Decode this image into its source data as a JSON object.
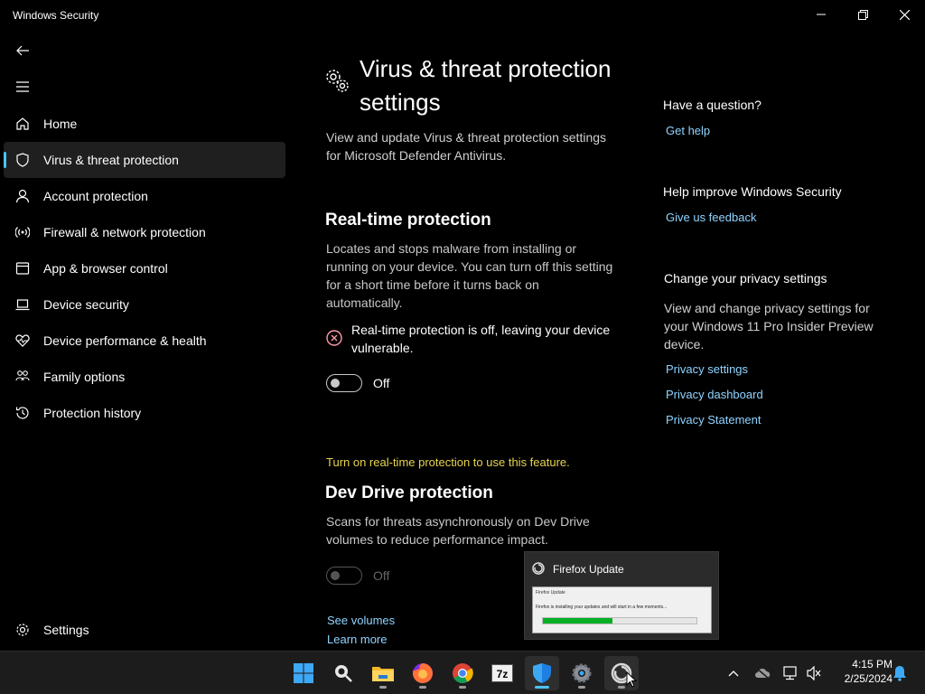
{
  "window": {
    "title": "Windows Security"
  },
  "sidebar": {
    "items": [
      {
        "label": "Home",
        "icon": "home-icon"
      },
      {
        "label": "Virus & threat protection",
        "icon": "shield-icon",
        "active": true
      },
      {
        "label": "Account protection",
        "icon": "person-icon"
      },
      {
        "label": "Firewall & network protection",
        "icon": "wifi-signal-icon"
      },
      {
        "label": "App & browser control",
        "icon": "app-window-icon"
      },
      {
        "label": "Device security",
        "icon": "laptop-icon"
      },
      {
        "label": "Device performance & health",
        "icon": "heart-pulse-icon"
      },
      {
        "label": "Family options",
        "icon": "family-icon"
      },
      {
        "label": "Protection history",
        "icon": "history-icon"
      }
    ],
    "settings_label": "Settings"
  },
  "main": {
    "title": "Virus & threat protection settings",
    "description": "View and update Virus & threat protection settings for Microsoft Defender Antivirus.",
    "realtime": {
      "title": "Real-time protection",
      "description": "Locates and stops malware from installing or running on your device. You can turn off this setting for a short time before it turns back on automatically.",
      "warning": "Real-time protection is off, leaving your device vulnerable.",
      "toggle_label": "Off"
    },
    "notice": "Turn on real-time protection to use this feature.",
    "devdrive": {
      "title": "Dev Drive protection",
      "description": "Scans for threats asynchronously on Dev Drive volumes to reduce performance impact.",
      "toggle_label": "Off",
      "see_volumes": "See volumes",
      "learn_more": "Learn more"
    }
  },
  "aside": {
    "question_title": "Have a question?",
    "get_help": "Get help",
    "improve_title": "Help improve Windows Security",
    "feedback": "Give us feedback",
    "privacy_title": "Change your privacy settings",
    "privacy_text": "View and change privacy settings for your Windows 11 Pro Insider Preview device.",
    "privacy_settings": "Privacy settings",
    "privacy_dashboard": "Privacy dashboard",
    "privacy_statement": "Privacy Statement"
  },
  "popup": {
    "title": "Firefox Update",
    "thumb_title": "Firefox Update",
    "thumb_text": "Firefox is installing your updates and will start in a few moments...",
    "progress": 0.45
  },
  "taskbar": {
    "time": "4:15 PM",
    "date": "2/25/2024",
    "sevenzip_label": "7z"
  },
  "colors": {
    "accent": "#4cc2ff",
    "link": "#8fd3ff",
    "notice": "#e8d44d",
    "error": "#ff99a4"
  }
}
